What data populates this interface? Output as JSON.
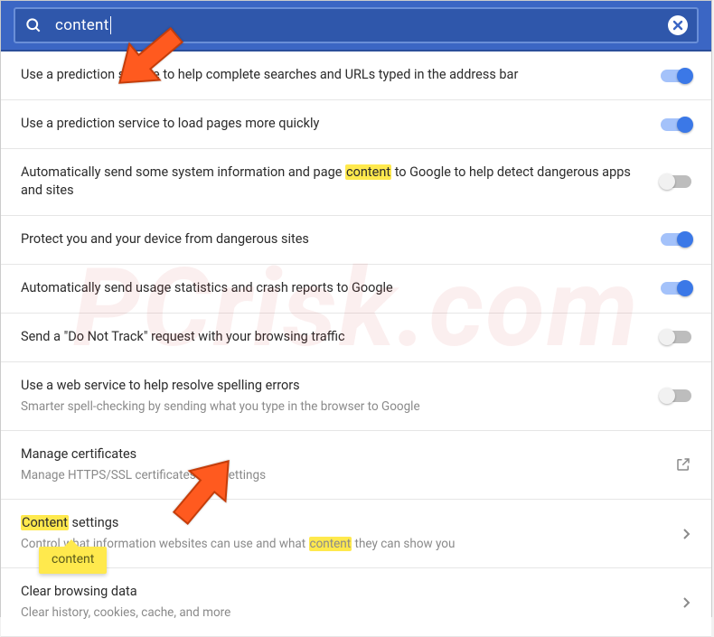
{
  "search": {
    "value": "content",
    "highlight_term": "content"
  },
  "tooltip": "content",
  "rows": [
    {
      "title_pre": "Use a prediction service to help complete searches and URLs typed in the address bar",
      "hl": "",
      "title_post": "",
      "sub": "",
      "control": "toggle",
      "on": true,
      "link": false
    },
    {
      "title_pre": "Use a prediction service to load pages more quickly",
      "hl": "",
      "title_post": "",
      "sub": "",
      "control": "toggle",
      "on": true,
      "link": false
    },
    {
      "title_pre": "Automatically send some system information and page ",
      "hl": "content",
      "title_post": " to Google to help detect dangerous apps and sites",
      "sub": "",
      "control": "toggle",
      "on": false,
      "link": false
    },
    {
      "title_pre": "Protect you and your device from dangerous sites",
      "hl": "",
      "title_post": "",
      "sub": "",
      "control": "toggle",
      "on": true,
      "link": false
    },
    {
      "title_pre": "Automatically send usage statistics and crash reports to Google",
      "hl": "",
      "title_post": "",
      "sub": "",
      "control": "toggle",
      "on": true,
      "link": false
    },
    {
      "title_pre": "Send a \"Do Not Track\" request with your browsing traffic",
      "hl": "",
      "title_post": "",
      "sub": "",
      "control": "toggle",
      "on": false,
      "link": false
    },
    {
      "title_pre": "Use a web service to help resolve spelling errors",
      "hl": "",
      "title_post": "",
      "sub": "Smarter spell-checking by sending what you type in the browser to Google",
      "control": "toggle",
      "on": false,
      "link": false
    },
    {
      "title_pre": "Manage certificates",
      "hl": "",
      "title_post": "",
      "sub": "Manage HTTPS/SSL certificates and settings",
      "control": "external",
      "on": false,
      "link": true
    },
    {
      "title_pre": "",
      "hl": "Content",
      "title_post": " settings",
      "sub_pre": "Control what information websites can use and what ",
      "sub_hl": "content",
      "sub_post": " they can show you",
      "control": "chevron",
      "on": false,
      "link": true
    },
    {
      "title_pre": "Clear browsing data",
      "hl": "",
      "title_post": "",
      "sub": "Clear history, cookies, cache, and more",
      "control": "chevron",
      "on": false,
      "link": true
    }
  ]
}
